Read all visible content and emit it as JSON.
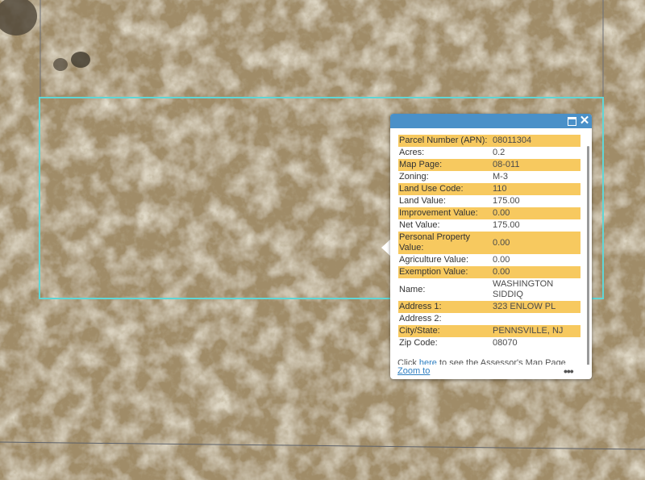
{
  "popup": {
    "fields": [
      {
        "label": "Parcel Number (APN):",
        "value": "08011304"
      },
      {
        "label": "Acres:",
        "value": "0.2"
      },
      {
        "label": "Map Page:",
        "value": "08-011"
      },
      {
        "label": "Zoning:",
        "value": "M-3"
      },
      {
        "label": "Land Use Code:",
        "value": "110"
      },
      {
        "label": "Land Value:",
        "value": "175.00"
      },
      {
        "label": "Improvement Value:",
        "value": "0.00"
      },
      {
        "label": "Net Value:",
        "value": "175.00"
      },
      {
        "label": "Personal Property Value:",
        "value": "0.00"
      },
      {
        "label": "Agriculture Value:",
        "value": "0.00"
      },
      {
        "label": "Exemption Value:",
        "value": "0.00"
      },
      {
        "label": "Name:",
        "value": "WASHINGTON SIDDIQ"
      },
      {
        "label": "Address 1:",
        "value": "323 ENLOW PL"
      },
      {
        "label": "Address 2:",
        "value": ""
      },
      {
        "label": "City/State:",
        "value": "PENNSVILLE, NJ"
      },
      {
        "label": "Zip Code:",
        "value": "08070"
      }
    ],
    "link_prefix": "Click",
    "link_text": "here",
    "link_suffix": "to see the Assessor's Map Page",
    "zoom_label": "Zoom to",
    "more_label": "•••"
  },
  "colors": {
    "parcel_outline": "#5fd6d6",
    "header": "#4a90c8",
    "row_highlight": "#f7c95f"
  }
}
